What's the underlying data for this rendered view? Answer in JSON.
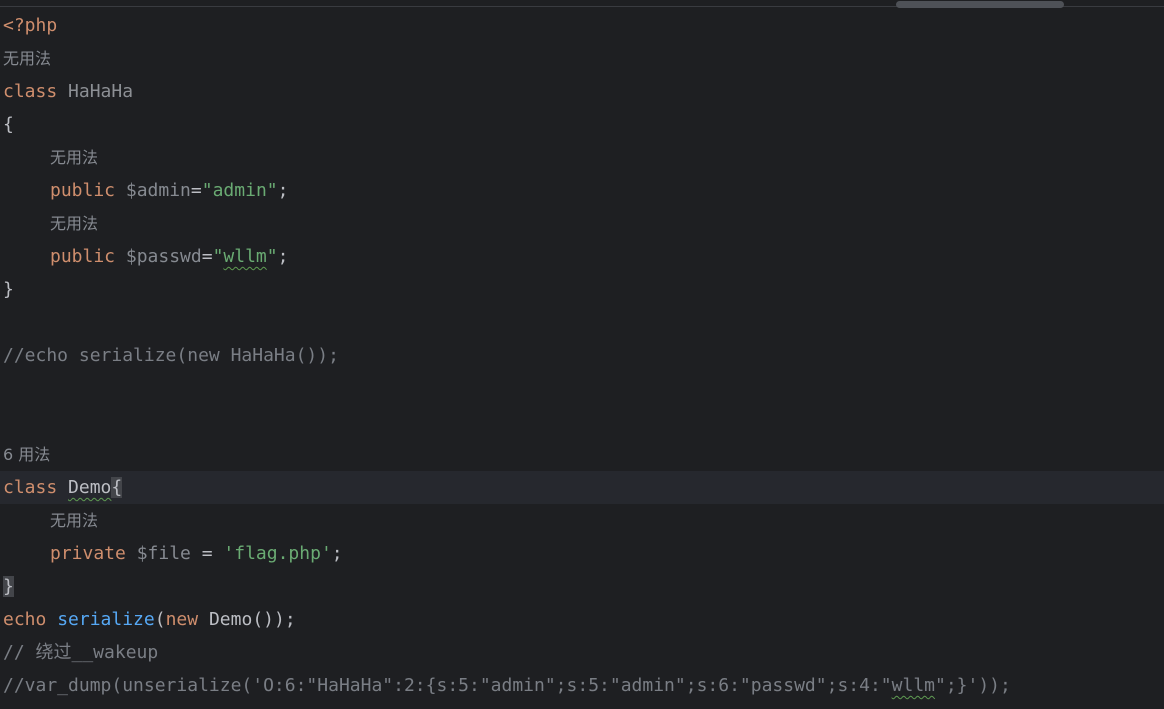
{
  "editor": {
    "lines": {
      "l1": {
        "tag": "<?php"
      },
      "l2": {
        "hint": "无用法"
      },
      "l3": {
        "kw": "class",
        "name": "HaHaHa"
      },
      "l4": {
        "brace": "{"
      },
      "l5": {
        "hint": "无用法"
      },
      "l6": {
        "kw": "public",
        "var": "$admin",
        "eq": "=",
        "str_open": "\"",
        "str": "admin",
        "str_close": "\"",
        "end": ";"
      },
      "l7": {
        "hint": "无用法"
      },
      "l8": {
        "kw": "public",
        "var": "$passwd",
        "eq": "=",
        "str_open": "\"",
        "str": "wllm",
        "str_close": "\"",
        "end": ";"
      },
      "l9": {
        "brace": "}"
      },
      "l10": {
        "comment": "//echo serialize(new HaHaHa());"
      },
      "l11": {
        "hint": "6 用法"
      },
      "l12": {
        "kw": "class",
        "name": "Demo",
        "brace": "{"
      },
      "l13": {
        "hint": "无用法"
      },
      "l14": {
        "kw": "private",
        "var": "$file",
        "eq": " = ",
        "str": "'flag.php'",
        "end": ";"
      },
      "l15": {
        "brace": "}"
      },
      "l16": {
        "kw1": "echo",
        "fn": "serialize",
        "open": "(",
        "kw2": "new",
        "cls": "Demo",
        "rest": "());"
      },
      "l17": {
        "comment": "// 绕过__wakeup"
      },
      "l18": {
        "comment_a": "//var_dump(unserialize('O:6:\"HaHaHa\":2:{s:5:\"admin\";s:5:\"admin\";s:6:\"passwd\";s:4:\"",
        "typo": "wllm",
        "comment_b": "\";}'));"
      }
    }
  }
}
